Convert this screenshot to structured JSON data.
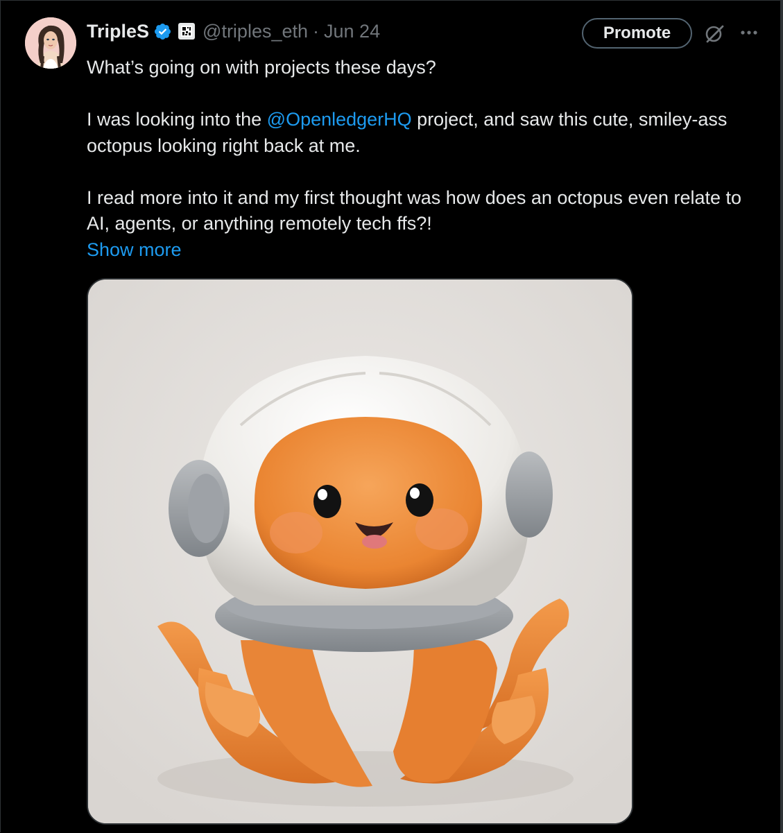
{
  "tweet": {
    "author_name": "TripleS",
    "handle": "@triples_eth",
    "separator": "·",
    "date": "Jun 24",
    "promote_label": "Promote",
    "text_line1": "What’s going on with projects these days?",
    "text_p2_before": "I was looking into the ",
    "mention": "@OpenledgerHQ",
    "text_p2_after": " project, and saw this cute, smiley-ass octopus looking right back at me.",
    "text_p3": "I read more into it and my first thought was how does an octopus even relate to AI, agents, or anything remotely tech ffs?!",
    "show_more": "Show more",
    "icons": {
      "avatar": "avatar-image",
      "verified": "verified-badge-icon",
      "affiliation": "affiliate-badge-icon",
      "grok": "grok-icon",
      "more": "more-options-icon"
    },
    "media": {
      "subject": "Orange cartoon octopus wearing a white puffy astronaut helmet"
    }
  },
  "colors": {
    "background": "#000000",
    "text": "#e7e9ea",
    "muted": "#71767b",
    "link": "#1d9bf0",
    "border": "#2f3336"
  }
}
